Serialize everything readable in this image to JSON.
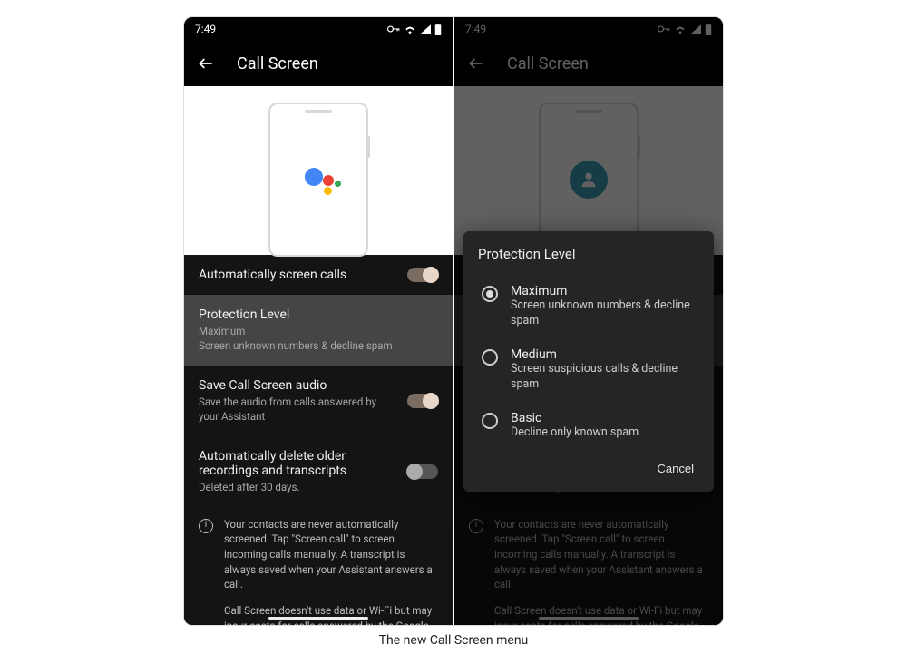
{
  "status_time": "7:49",
  "status_icons": [
    "vpn-key-icon",
    "wifi-icon",
    "signal-icon",
    "battery-icon"
  ],
  "app_bar": {
    "title": "Call Screen"
  },
  "settings": {
    "auto_screen": {
      "label": "Automatically screen calls",
      "on": true
    },
    "protection": {
      "label": "Protection Level",
      "value_title": "Maximum",
      "value_sub": "Screen unknown numbers & decline spam"
    },
    "save_audio": {
      "label": "Save Call Screen audio",
      "sub": "Save the audio from calls answered by your Assistant",
      "on": true
    },
    "auto_delete": {
      "label": "Automatically delete older recordings and transcripts",
      "sub": "Deleted after 30 days.",
      "on": false
    },
    "info_para1": "Your contacts are never automatically screened. Tap \"Screen call\" to screen incoming calls manually. A transcript is always saved when your Assistant answers a call.",
    "info_para2": "Call Screen doesn't use data or Wi-Fi but may incur costs for calls answered by the Google Assistant."
  },
  "dialog": {
    "title": "Protection Level",
    "options": [
      {
        "label": "Maximum",
        "sub": "Screen unknown numbers & decline spam",
        "checked": true
      },
      {
        "label": "Medium",
        "sub": "Screen suspicious calls & decline spam",
        "checked": false
      },
      {
        "label": "Basic",
        "sub": "Decline only known spam",
        "checked": false
      }
    ],
    "cancel": "Cancel"
  },
  "caption": "The new Call Screen menu"
}
